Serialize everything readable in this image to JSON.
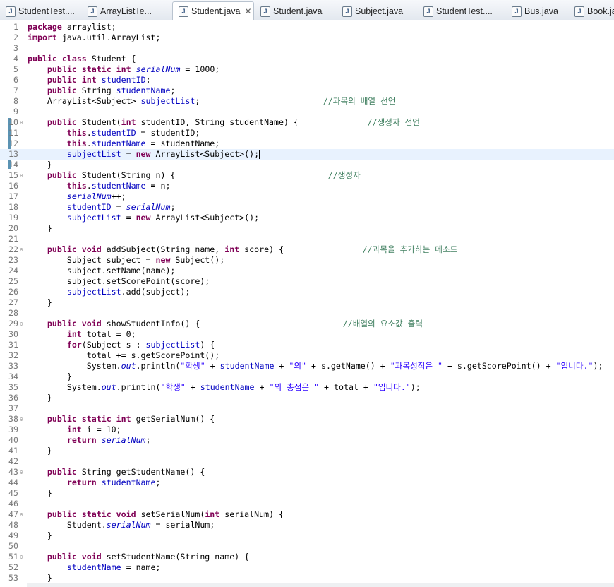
{
  "tabs": [
    {
      "label": "StudentTest....",
      "active": false
    },
    {
      "label": "ArrayListTe...",
      "active": false
    },
    {
      "label": "Student.java",
      "active": true
    },
    {
      "label": "Student.java",
      "active": false
    },
    {
      "label": "Subject.java",
      "active": false
    },
    {
      "label": "StudentTest....",
      "active": false
    },
    {
      "label": "Bus.java",
      "active": false
    },
    {
      "label": "Book.java",
      "active": false
    }
  ],
  "tab_icon_glyph": "J",
  "close_glyph": "✕",
  "fold_glyph": "⊖",
  "current_line": 13,
  "fold_lines": [
    10,
    15,
    22,
    29,
    38,
    43,
    47,
    51
  ],
  "colors": {
    "keyword": "#7f0055",
    "field": "#0000c0",
    "string": "#2a00ff",
    "comment": "#3f7f5f",
    "current_line_bg": "#e8f2fe"
  },
  "lines": [
    [
      [
        "k",
        "package"
      ],
      [
        "p",
        " arraylist;"
      ]
    ],
    [
      [
        "k",
        "import"
      ],
      [
        "p",
        " java.util.ArrayList;"
      ]
    ],
    [],
    [
      [
        "k",
        "public"
      ],
      [
        "p",
        " "
      ],
      [
        "k",
        "class"
      ],
      [
        "p",
        " Student {"
      ]
    ],
    [
      [
        "p",
        "    "
      ],
      [
        "k",
        "public"
      ],
      [
        "p",
        " "
      ],
      [
        "k",
        "static"
      ],
      [
        "p",
        " "
      ],
      [
        "k",
        "int"
      ],
      [
        "p",
        " "
      ],
      [
        "s",
        "serialNum"
      ],
      [
        "p",
        " = 1000;"
      ]
    ],
    [
      [
        "p",
        "    "
      ],
      [
        "k",
        "public"
      ],
      [
        "p",
        " "
      ],
      [
        "k",
        "int"
      ],
      [
        "p",
        " "
      ],
      [
        "f",
        "studentID"
      ],
      [
        "p",
        ";"
      ]
    ],
    [
      [
        "p",
        "    "
      ],
      [
        "k",
        "public"
      ],
      [
        "p",
        " String "
      ],
      [
        "f",
        "studentName"
      ],
      [
        "p",
        ";"
      ]
    ],
    [
      [
        "p",
        "    ArrayList<Subject> "
      ],
      [
        "f",
        "subjectList"
      ],
      [
        "p",
        ";                         "
      ],
      [
        "c",
        "//과목의 배열 선언"
      ]
    ],
    [],
    [
      [
        "p",
        "    "
      ],
      [
        "k",
        "public"
      ],
      [
        "p",
        " Student("
      ],
      [
        "k",
        "int"
      ],
      [
        "p",
        " studentID, String studentName) {              "
      ],
      [
        "c",
        "//생성자 선언"
      ]
    ],
    [
      [
        "p",
        "        "
      ],
      [
        "k",
        "this"
      ],
      [
        "p",
        "."
      ],
      [
        "f",
        "studentID"
      ],
      [
        "p",
        " = studentID;"
      ]
    ],
    [
      [
        "p",
        "        "
      ],
      [
        "k",
        "this"
      ],
      [
        "p",
        "."
      ],
      [
        "f",
        "studentName"
      ],
      [
        "p",
        " = studentName;"
      ]
    ],
    [
      [
        "p",
        "        "
      ],
      [
        "f",
        "subjectList"
      ],
      [
        "p",
        " = "
      ],
      [
        "k",
        "new"
      ],
      [
        "p",
        " ArrayList<Subject>();"
      ]
    ],
    [
      [
        "p",
        "    }"
      ]
    ],
    [
      [
        "p",
        "    "
      ],
      [
        "k",
        "public"
      ],
      [
        "p",
        " Student(String n) {                               "
      ],
      [
        "c",
        "//생성자"
      ]
    ],
    [
      [
        "p",
        "        "
      ],
      [
        "k",
        "this"
      ],
      [
        "p",
        "."
      ],
      [
        "f",
        "studentName"
      ],
      [
        "p",
        " = n;"
      ]
    ],
    [
      [
        "p",
        "        "
      ],
      [
        "s",
        "serialNum"
      ],
      [
        "p",
        "++;"
      ]
    ],
    [
      [
        "p",
        "        "
      ],
      [
        "f",
        "studentID"
      ],
      [
        "p",
        " = "
      ],
      [
        "s",
        "serialNum"
      ],
      [
        "p",
        ";"
      ]
    ],
    [
      [
        "p",
        "        "
      ],
      [
        "f",
        "subjectList"
      ],
      [
        "p",
        " = "
      ],
      [
        "k",
        "new"
      ],
      [
        "p",
        " ArrayList<Subject>();"
      ]
    ],
    [
      [
        "p",
        "    }"
      ]
    ],
    [],
    [
      [
        "p",
        "    "
      ],
      [
        "k",
        "public"
      ],
      [
        "p",
        " "
      ],
      [
        "k",
        "void"
      ],
      [
        "p",
        " addSubject(String name, "
      ],
      [
        "k",
        "int"
      ],
      [
        "p",
        " score) {                "
      ],
      [
        "c",
        "//과목을 추가하는 메소드"
      ]
    ],
    [
      [
        "p",
        "        Subject subject = "
      ],
      [
        "k",
        "new"
      ],
      [
        "p",
        " Subject();"
      ]
    ],
    [
      [
        "p",
        "        subject.setName(name);"
      ]
    ],
    [
      [
        "p",
        "        subject.setScorePoint(score);"
      ]
    ],
    [
      [
        "p",
        "        "
      ],
      [
        "f",
        "subjectList"
      ],
      [
        "p",
        ".add(subject);"
      ]
    ],
    [
      [
        "p",
        "    }"
      ]
    ],
    [],
    [
      [
        "p",
        "    "
      ],
      [
        "k",
        "public"
      ],
      [
        "p",
        " "
      ],
      [
        "k",
        "void"
      ],
      [
        "p",
        " showStudentInfo() {                             "
      ],
      [
        "c",
        "//배열의 요소값 출력"
      ]
    ],
    [
      [
        "p",
        "        "
      ],
      [
        "k",
        "int"
      ],
      [
        "p",
        " total = 0;"
      ]
    ],
    [
      [
        "p",
        "        "
      ],
      [
        "k",
        "for"
      ],
      [
        "p",
        "(Subject s : "
      ],
      [
        "f",
        "subjectList"
      ],
      [
        "p",
        ") {"
      ]
    ],
    [
      [
        "p",
        "            total += s.getScorePoint();"
      ]
    ],
    [
      [
        "p",
        "            System."
      ],
      [
        "s",
        "out"
      ],
      [
        "p",
        ".println("
      ],
      [
        "t",
        "\"학생\""
      ],
      [
        "p",
        " + "
      ],
      [
        "f",
        "studentName"
      ],
      [
        "p",
        " + "
      ],
      [
        "t",
        "\"의\""
      ],
      [
        "p",
        " + s.getName() + "
      ],
      [
        "t",
        "\"과목성적은 \""
      ],
      [
        "p",
        " + s.getScorePoint() + "
      ],
      [
        "t",
        "\"입니다.\""
      ],
      [
        "p",
        ");"
      ]
    ],
    [
      [
        "p",
        "        }"
      ]
    ],
    [
      [
        "p",
        "        System."
      ],
      [
        "s",
        "out"
      ],
      [
        "p",
        ".println("
      ],
      [
        "t",
        "\"학생\""
      ],
      [
        "p",
        " + "
      ],
      [
        "f",
        "studentName"
      ],
      [
        "p",
        " + "
      ],
      [
        "t",
        "\"의 총점은 \""
      ],
      [
        "p",
        " + total + "
      ],
      [
        "t",
        "\"입니다.\""
      ],
      [
        "p",
        ");"
      ]
    ],
    [
      [
        "p",
        "    }"
      ]
    ],
    [],
    [
      [
        "p",
        "    "
      ],
      [
        "k",
        "public"
      ],
      [
        "p",
        " "
      ],
      [
        "k",
        "static"
      ],
      [
        "p",
        " "
      ],
      [
        "k",
        "int"
      ],
      [
        "p",
        " getSerialNum() {"
      ]
    ],
    [
      [
        "p",
        "        "
      ],
      [
        "k",
        "int"
      ],
      [
        "p",
        " i = 10;"
      ]
    ],
    [
      [
        "p",
        "        "
      ],
      [
        "k",
        "return"
      ],
      [
        "p",
        " "
      ],
      [
        "s",
        "serialNum"
      ],
      [
        "p",
        ";"
      ]
    ],
    [
      [
        "p",
        "    }"
      ]
    ],
    [],
    [
      [
        "p",
        "    "
      ],
      [
        "k",
        "public"
      ],
      [
        "p",
        " String getStudentName() {"
      ]
    ],
    [
      [
        "p",
        "        "
      ],
      [
        "k",
        "return"
      ],
      [
        "p",
        " "
      ],
      [
        "f",
        "studentName"
      ],
      [
        "p",
        ";"
      ]
    ],
    [
      [
        "p",
        "    }"
      ]
    ],
    [],
    [
      [
        "p",
        "    "
      ],
      [
        "k",
        "public"
      ],
      [
        "p",
        " "
      ],
      [
        "k",
        "static"
      ],
      [
        "p",
        " "
      ],
      [
        "k",
        "void"
      ],
      [
        "p",
        " setSerialNum("
      ],
      [
        "k",
        "int"
      ],
      [
        "p",
        " serialNum) {"
      ]
    ],
    [
      [
        "p",
        "        Student."
      ],
      [
        "s",
        "serialNum"
      ],
      [
        "p",
        " = serialNum;"
      ]
    ],
    [
      [
        "p",
        "    }"
      ]
    ],
    [],
    [
      [
        "p",
        "    "
      ],
      [
        "k",
        "public"
      ],
      [
        "p",
        " "
      ],
      [
        "k",
        "void"
      ],
      [
        "p",
        " setStudentName(String name) {"
      ]
    ],
    [
      [
        "p",
        "        "
      ],
      [
        "f",
        "studentName"
      ],
      [
        "p",
        " = name;"
      ]
    ],
    [
      [
        "p",
        "    }"
      ]
    ]
  ]
}
